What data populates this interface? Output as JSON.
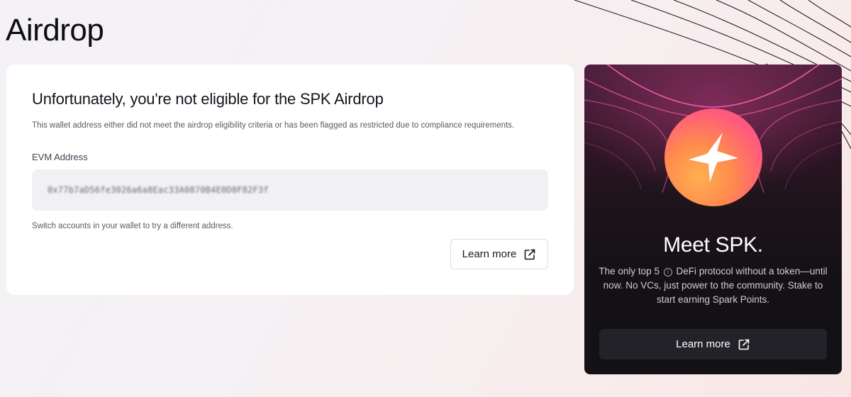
{
  "page": {
    "title": "Airdrop"
  },
  "eligibility_card": {
    "title": "Unfortunately, you're not eligible for the SPK Airdrop",
    "description": "This wallet address either did not meet the airdrop eligibility criteria or has been flagged as restricted due to compliance requirements.",
    "address_label": "EVM Address",
    "address_value": "0x77b7aD56fe3026a6a8Eac33A0870B4E0D0F82F3f",
    "switch_note": "Switch accounts in your wallet to try a different address.",
    "learn_more_label": "Learn more",
    "learn_more_icon": "external-link-icon"
  },
  "promo_card": {
    "logo_icon": "spark-star-icon",
    "title": "Meet SPK.",
    "text_before_info": "The only top 5",
    "info_icon": "info-icon",
    "text_after_info": "DeFi protocol without a token—until now. No VCs, just power to the community. Stake to start earning Spark Points.",
    "learn_more_label": "Learn more",
    "learn_more_icon": "external-link-icon"
  },
  "colors": {
    "page_background": "#f5f1f4",
    "card_background": "#ffffff",
    "address_background": "#f1f0f5",
    "promo_background": "#131115",
    "promo_button": "#232228",
    "coin_gradient_start": "#ffb050",
    "coin_gradient_end": "#f24a9a"
  }
}
